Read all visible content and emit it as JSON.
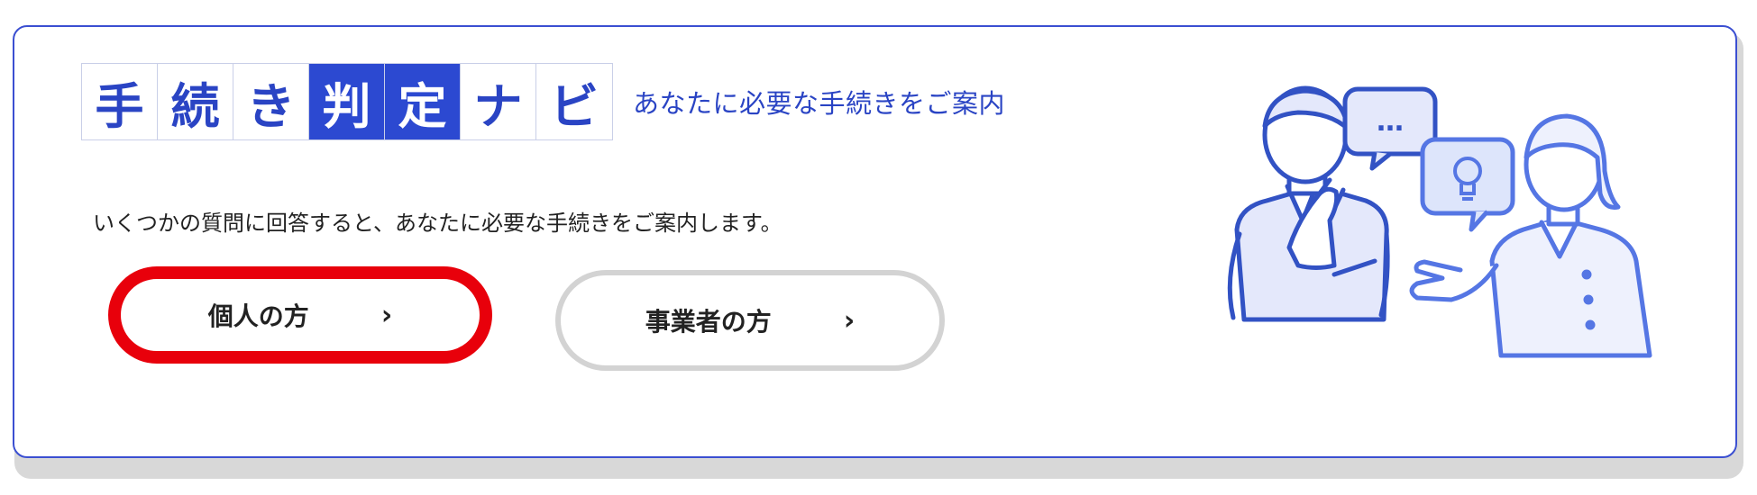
{
  "navi": {
    "logo_chars": [
      "手",
      "続",
      "き",
      "判",
      "定",
      "ナ",
      "ビ"
    ],
    "tagline": "あなたに必要な手続きをご案内",
    "description": "いくつかの質問に回答すると、あなたに必要な手続きをご案内します。"
  },
  "buttons": {
    "individual": {
      "label": "個人の方",
      "chevron": "›"
    },
    "business": {
      "label": "事業者の方",
      "chevron": "›"
    }
  },
  "illustration": {
    "speech_bubble_text": "…",
    "bulb_icon": "lightbulb-icon"
  },
  "colors": {
    "accent": "#2c49d1",
    "highlight_ring": "#e8000b",
    "card_border": "#3b4fd1"
  }
}
